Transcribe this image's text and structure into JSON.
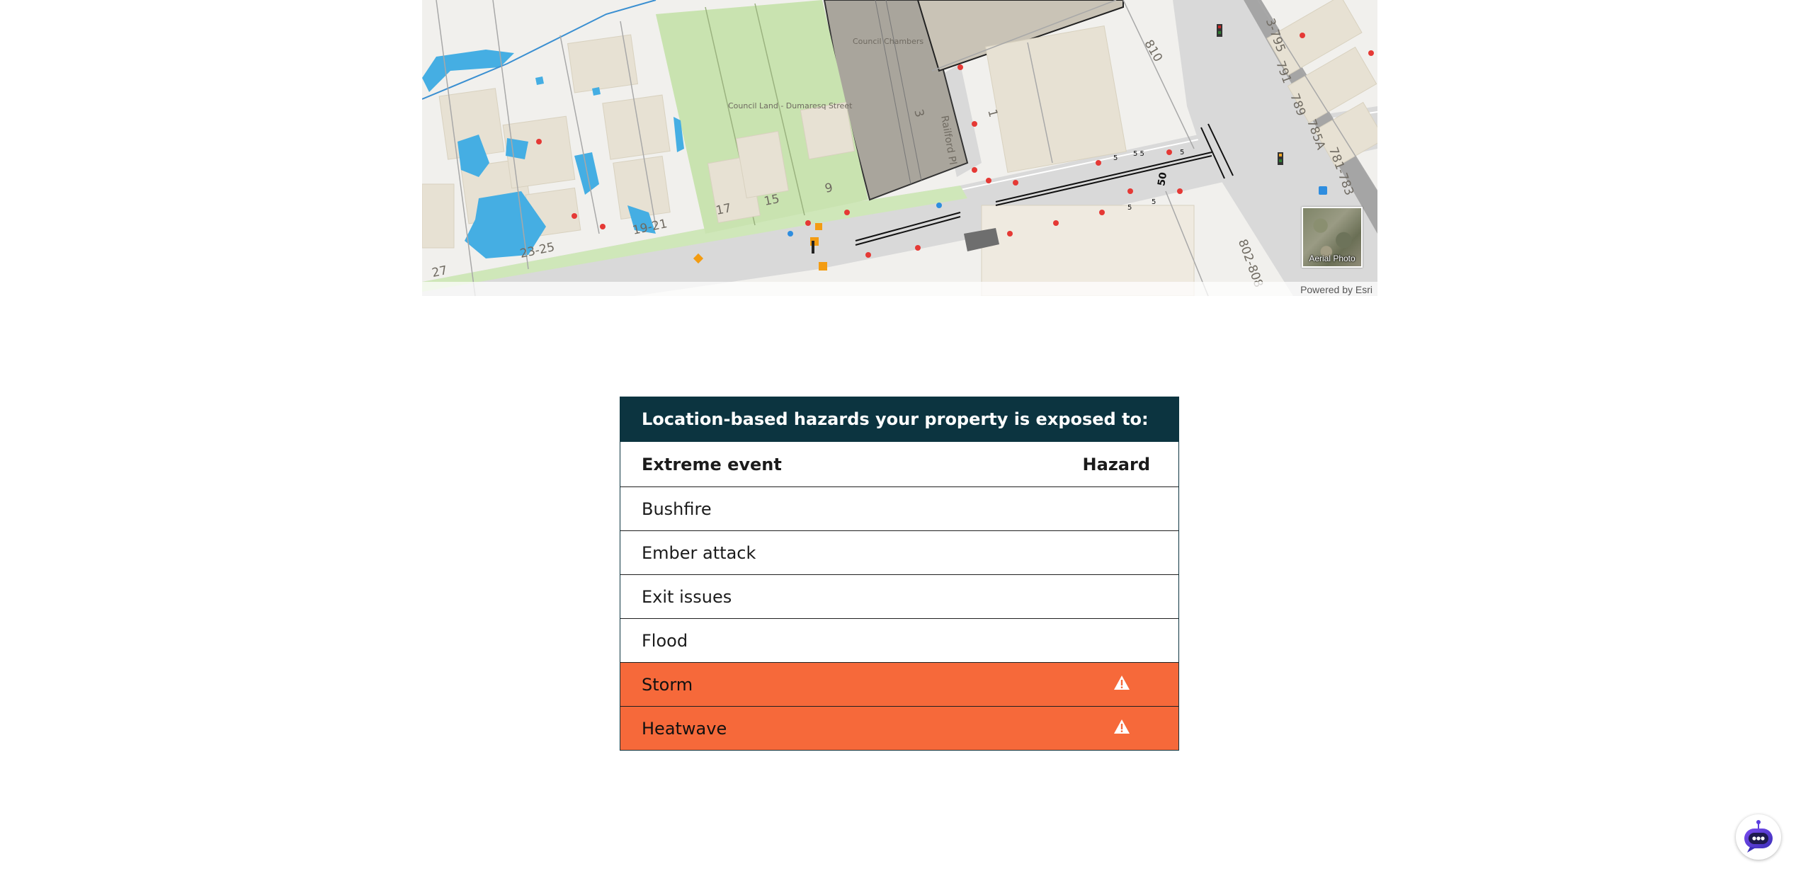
{
  "map": {
    "labels": {
      "street_numbers": [
        "810",
        "1",
        "3",
        "9",
        "15",
        "17",
        "19-21",
        "23-25",
        "27",
        "802-808",
        "3-795",
        "791",
        "789",
        "785A",
        "781-783"
      ],
      "road_name": "Railford Pl",
      "building_name_1": "Council Chambers",
      "building_name_2": "Council Land - Dumaresq Street",
      "road_marking": "50",
      "small_marks": [
        "5",
        "5",
        "5",
        "5",
        "5 5"
      ]
    },
    "aerial_toggle_label": "Aerial Photo",
    "attribution": "Powered by Esri",
    "colors": {
      "base": "#f1f0ed",
      "building": "#e7e1d3",
      "parkland": "#c9e3b0",
      "council_block": "#a9a59c",
      "road": "#d4d4d4",
      "water": "#45aee3"
    }
  },
  "hazards": {
    "title": "Location-based hazards your property is exposed to:",
    "column_event": "Extreme event",
    "column_hazard": "Hazard",
    "rows": [
      {
        "event": "Bushfire",
        "exposed": false
      },
      {
        "event": "Ember attack",
        "exposed": false
      },
      {
        "event": "Exit issues",
        "exposed": false
      },
      {
        "event": "Flood",
        "exposed": false
      },
      {
        "event": "Storm",
        "exposed": true,
        "icon": "warning-icon"
      },
      {
        "event": "Heatwave",
        "exposed": true,
        "icon": "warning-icon"
      }
    ],
    "colors": {
      "header_bg": "#0c3440",
      "flagged_bg": "#f6693a"
    }
  },
  "chatbot": {
    "icon": "chatbot-icon"
  }
}
